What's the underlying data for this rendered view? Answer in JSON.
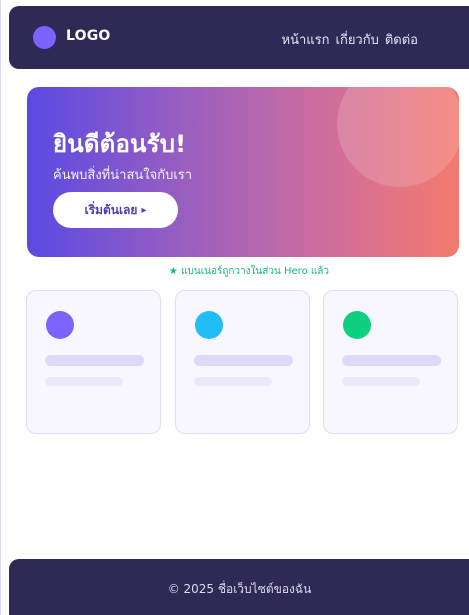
{
  "header": {
    "logo_text": "LOGO",
    "nav": [
      "หน้าแรก",
      "เกี่ยวกับ",
      "ติดต่อ"
    ]
  },
  "hero": {
    "title": "ยินดีต้อนรับ!",
    "subtitle": "ค้นพบสิ่งที่น่าสนใจกับเรา",
    "cta_label": "เริ่มต้นเลย",
    "cta_arrow": "▸"
  },
  "notice": "★ แบนเนอร์ถูกวางในส่วน Hero แล้ว",
  "cards": [
    {
      "dot_color": "#7c63ff"
    },
    {
      "dot_color": "#20bef5"
    },
    {
      "dot_color": "#0fd07e"
    }
  ],
  "footer": {
    "text": "© 2025 ชื่อเว็บไซต์ของฉัน"
  },
  "colors": {
    "header_bg": "#2f2a55",
    "accent": "#7c63ff",
    "notice_green": "#12b886"
  }
}
